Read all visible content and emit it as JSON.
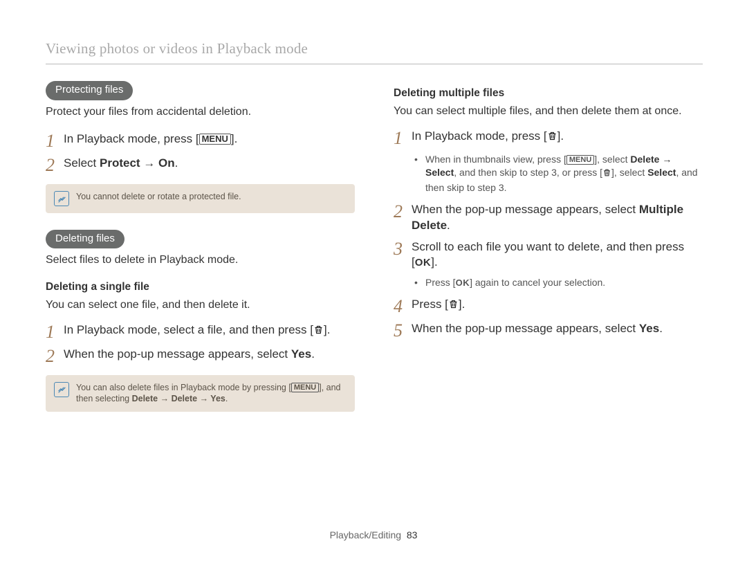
{
  "header": {
    "title": "Viewing photos or videos in Playback mode"
  },
  "footer": {
    "section": "Playback/Editing",
    "page": "83"
  },
  "left": {
    "protecting": {
      "pill": "Protecting files",
      "desc": "Protect your files from accidental deletion.",
      "step1_pre": "In Playback mode, press [",
      "step1_post": "].",
      "step2_pre": "Select ",
      "step2_bold": "Protect → On",
      "step2_post": ".",
      "note": "You cannot delete or rotate a protected file."
    },
    "deleting": {
      "pill": "Deleting files",
      "desc": "Select files to delete in Playback mode.",
      "single": {
        "heading": "Deleting a single file",
        "desc": "You can select one file, and then delete it.",
        "step1_pre": "In Playback mode, select a file, and then press [",
        "step1_post": "].",
        "step2_pre": "When the pop-up message appears, select ",
        "step2_bold": "Yes",
        "step2_post": ".",
        "note_pre": "You can also delete files in Playback mode by pressing [",
        "note_mid": "], and then selecting ",
        "note_bold": "Delete → Delete → Yes",
        "note_post": "."
      }
    }
  },
  "right": {
    "multi": {
      "heading": "Deleting multiple files",
      "desc": "You can select multiple files, and then delete them at once.",
      "step1_pre": "In Playback mode, press [",
      "step1_post": "].",
      "bullet1_pre": "When in thumbnails view, press [",
      "bullet1_mid1": "], select ",
      "bullet1_bold1": "Delete → Select",
      "bullet1_mid2": ", and then skip to step 3, or press [",
      "bullet1_mid3": "], select ",
      "bullet1_bold2": "Select",
      "bullet1_post": ", and then skip to step 3.",
      "step2_pre": "When the pop-up message appears, select ",
      "step2_bold": "Multiple Delete",
      "step2_post": ".",
      "step3_pre": "Scroll to each file you want to delete, and then press [",
      "step3_post": "].",
      "bullet3_pre": "Press [",
      "bullet3_post": "] again to cancel your selection.",
      "step4_pre": "Press [",
      "step4_post": "].",
      "step5_pre": "When the pop-up message appears, select ",
      "step5_bold": "Yes",
      "step5_post": "."
    }
  },
  "labels": {
    "menu": "MENU",
    "ok": "OK"
  }
}
